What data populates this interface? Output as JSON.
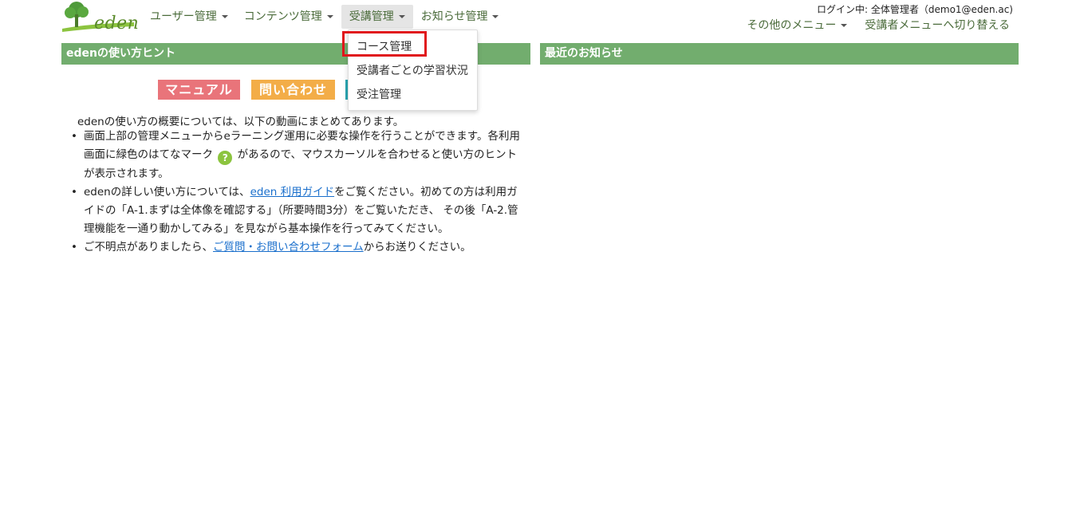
{
  "logo": {
    "text": "eden"
  },
  "nav": {
    "user_mgmt": "ユーザー管理",
    "content_mgmt": "コンテンツ管理",
    "course_mgmt": "受講管理",
    "notice_mgmt": "お知らせ管理"
  },
  "dropdown": {
    "item1": "コース管理",
    "item2": "受講者ごとの学習状況",
    "item3": "受注管理"
  },
  "header": {
    "login_info": "ログイン中: 全体管理者（demo1@eden.ac)",
    "other_menu": "その他のメニュー",
    "switch_menu": "受講者メニューへ切り替える"
  },
  "hint_panel": {
    "title": "edenの使い方ヒント",
    "btn_manual": "マニュアル",
    "btn_contact": "問い合わせ",
    "intro": "edenの使い方の概要については、以下の動画にまとめてあります。",
    "b1_a": "画面上部の管理メニューからeラーニング運用に必要な操作を行うことができます。各利用画面に緑色のはてなマーク",
    "b1_icon": "?",
    "b1_b": "があるので、マウスカーソルを合わせると使い方のヒントが表示されます。",
    "b2_a": "edenの詳しい使い方については、",
    "b2_link": "eden 利用ガイド",
    "b2_b": "をご覧ください。初めての方は利用ガイドの「A-1.まずは全体像を確認する」（所要時間3分）をご覧いただき、 その後「A-2.管理機能を一通り動かしてみる」を見ながら基本操作を行ってみてください。",
    "b3_a": "ご不明点がありましたら、",
    "b3_link": "ご質問・お問い合わせフォーム",
    "b3_b": "からお送りください。"
  },
  "news_panel": {
    "title": "最近のお知らせ"
  },
  "colors": {
    "panel_header": "#72ad6e",
    "btn_manual": "#e9747a",
    "btn_contact": "#f3ad48",
    "btn_third": "#2aa7b3",
    "highlight": "#e0151b",
    "link": "#1a6fcc"
  }
}
